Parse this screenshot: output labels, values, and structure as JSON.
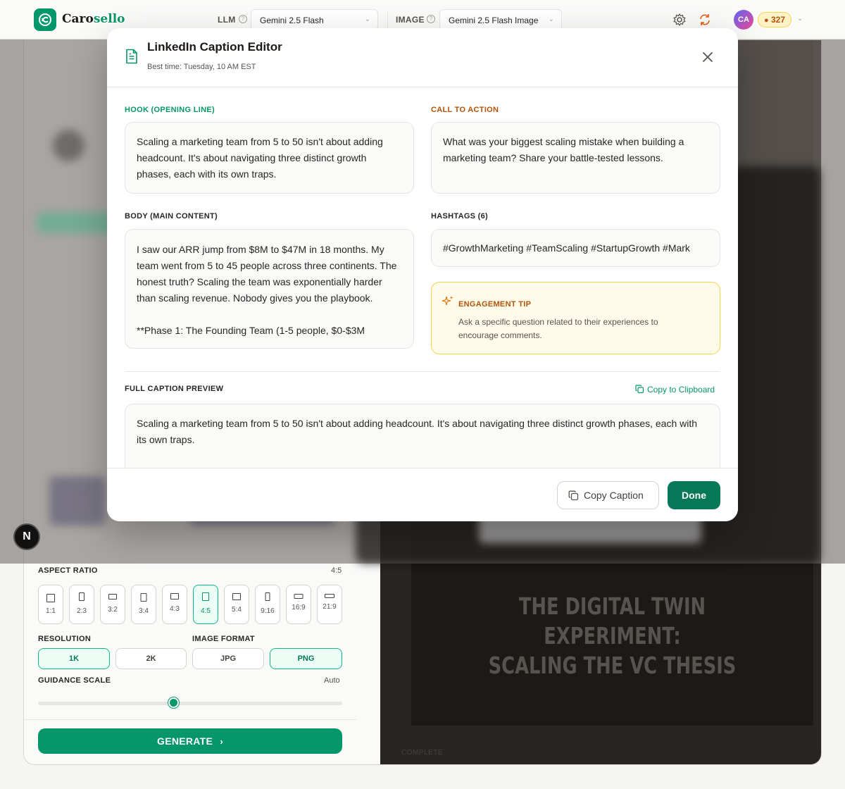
{
  "app": {
    "name_part1": "Caro",
    "name_part2": "sello"
  },
  "topbar": {
    "llm_label": "LLM",
    "llm_value": "Gemini 2.5 Flash",
    "image_label": "IMAGE",
    "image_value": "Gemini 2.5 Flash Image",
    "avatar_initials": "CA",
    "credits": "327"
  },
  "modal": {
    "title": "LinkedIn Caption Editor",
    "subtitle": "Best time: Tuesday, 10 AM EST",
    "hook_label": "HOOK (OPENING LINE)",
    "hook_text": "Scaling a marketing team from 5 to 50 isn't about adding headcount. It's about navigating three distinct growth phases, each with its own traps.",
    "cta_label": "CALL TO ACTION",
    "cta_text": "What was your biggest scaling mistake when building a marketing team? Share your battle-tested lessons.",
    "body_label": "BODY (MAIN CONTENT)",
    "body_p1": "I saw our ARR jump from $8M to $47M in 18 months. My team went from 5 to 45 people across three continents. The honest truth? Scaling the team was exponentially harder than scaling revenue. Nobody gives you the playbook.",
    "body_p2": "**Phase 1: The Founding Team (1-5 people, $0-$3M",
    "hashtags_label": "HASHTAGS (6)",
    "hashtags_text": "#GrowthMarketing #TeamScaling #StartupGrowth #Mark",
    "tip_title": "ENGAGEMENT TIP",
    "tip_text": "Ask a specific question related to their experiences to encourage comments.",
    "preview_label": "FULL CAPTION PREVIEW",
    "copy_clipboard": "Copy to Clipboard",
    "preview_text": "Scaling a marketing team from 5 to 50 isn't about adding headcount. It's about navigating three distinct growth phases, each with its own traps.",
    "copy_caption": "Copy Caption",
    "done": "Done"
  },
  "settings": {
    "aspect_label": "ASPECT RATIO",
    "aspect_value": "4:5",
    "aspect_options": [
      "1:1",
      "2:3",
      "3:2",
      "3:4",
      "4:3",
      "4:5",
      "5:4",
      "9:16",
      "16:9",
      "21:9"
    ],
    "resolution_label": "RESOLUTION",
    "resolution_options": [
      "1K",
      "2K"
    ],
    "format_label": "IMAGE FORMAT",
    "format_options": [
      "JPG",
      "PNG"
    ],
    "guidance_label": "GUIDANCE SCALE",
    "guidance_value": "Auto",
    "generate": "GENERATE"
  },
  "preview": {
    "title_line1": "THE DIGITAL TWIN EXPERIMENT:",
    "title_line2": "SCALING THE VC THESIS",
    "status": "COMPLETE"
  },
  "badge": {
    "letter": "N"
  },
  "colors": {
    "accent": "#059669",
    "accent_dark": "#047857",
    "amber": "#b45309"
  }
}
